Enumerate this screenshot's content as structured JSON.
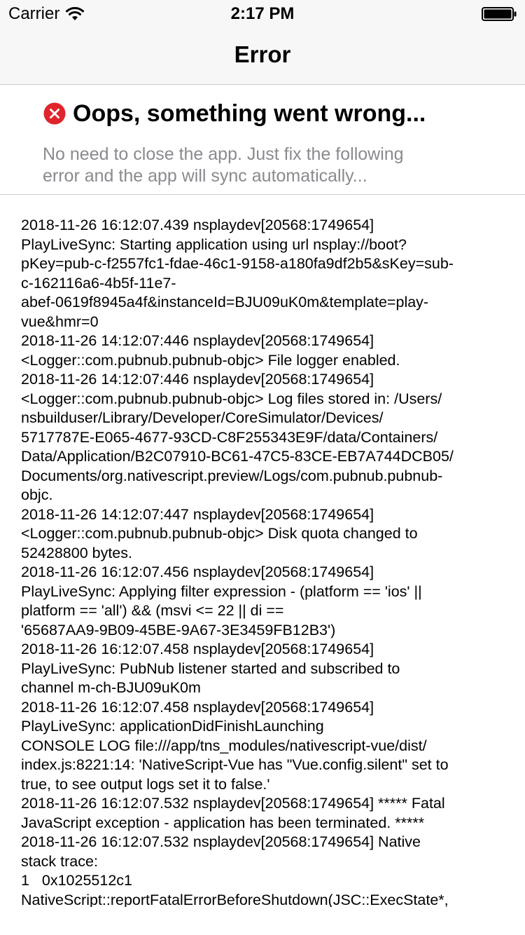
{
  "status_bar": {
    "carrier": "Carrier",
    "time": "2:17 PM",
    "icons": [
      "wifi-icon",
      "battery-icon"
    ]
  },
  "nav_bar": {
    "title": "Error"
  },
  "error_header": {
    "icon": "error-icon",
    "icon_color": "#e0242b",
    "title": "Oops, something went wrong...",
    "subtitle": "No need to close the app. Just fix the following\nerror and the app will sync automatically..."
  },
  "log": {
    "text": "2018-11-26 16:12:07.439 nsplaydev[20568:1749654]\nPlayLiveSync: Starting application using url nsplay://boot?\npKey=pub-c-f2557fc1-fdae-46c1-9158-a180fa9df2b5&sKey=sub-\nc-162116a6-4b5f-11e7-\nabef-0619f8945a4f&instanceId=BJU09uK0m&template=play-\nvue&hmr=0\n2018-11-26 14:12:07:446 nsplaydev[20568:1749654]\n<Logger::com.pubnub.pubnub-objc> File logger enabled.\n2018-11-26 14:12:07:446 nsplaydev[20568:1749654]\n<Logger::com.pubnub.pubnub-objc> Log files stored in: /Users/\nnsbuilduser/Library/Developer/CoreSimulator/Devices/\n5717787E-E065-4677-93CD-C8F255343E9F/data/Containers/\nData/Application/B2C07910-BC61-47C5-83CE-EB7A744DCB05/\nDocuments/org.nativescript.preview/Logs/com.pubnub.pubnub-\nobjc.\n2018-11-26 14:12:07:447 nsplaydev[20568:1749654]\n<Logger::com.pubnub.pubnub-objc> Disk quota changed to\n52428800 bytes.\n2018-11-26 16:12:07.456 nsplaydev[20568:1749654]\nPlayLiveSync: Applying filter expression - (platform == 'ios' ||\nplatform == 'all') && (msvi <= 22 || di ==\n'65687AA9-9B09-45BE-9A67-3E3459FB12B3')\n2018-11-26 16:12:07.458 nsplaydev[20568:1749654]\nPlayLiveSync: PubNub listener started and subscribed to\nchannel m-ch-BJU09uK0m\n2018-11-26 16:12:07.458 nsplaydev[20568:1749654]\nPlayLiveSync: applicationDidFinishLaunching\nCONSOLE LOG file:///app/tns_modules/nativescript-vue/dist/\nindex.js:8221:14: 'NativeScript-Vue has \"Vue.config.silent\" set to\ntrue, to see output logs set it to false.'\n2018-11-26 16:12:07.532 nsplaydev[20568:1749654] ***** Fatal\nJavaScript exception - application has been terminated. *****\n2018-11-26 16:12:07.532 nsplaydev[20568:1749654] Native\nstack trace:\n1   0x1025512c1\nNativeScript::reportFatalErrorBeforeShutdown(JSC::ExecState*,"
  }
}
